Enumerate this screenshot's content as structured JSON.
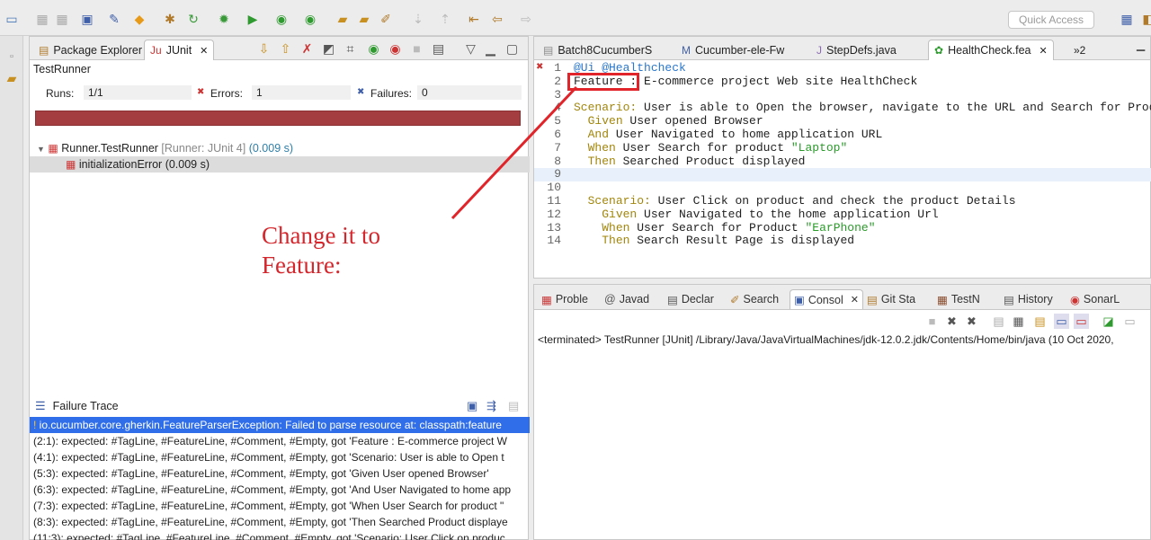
{
  "toolbar": {
    "quick_access_placeholder": "Quick Access"
  },
  "left_panel": {
    "tabs": [
      {
        "label": "Package Explorer"
      },
      {
        "label": "JUnit"
      }
    ],
    "runner_title": "TestRunner",
    "stats": {
      "runs_label": "Runs:",
      "runs_value": "1/1",
      "errors_label": "Errors:",
      "errors_value": "1",
      "failures_label": "Failures:",
      "failures_value": "0"
    },
    "progress": {
      "fraction": 1.0,
      "status": "failed",
      "color": "#a33d3f"
    },
    "tree": {
      "root": {
        "name": "Runner.TestRunner",
        "runner": "[Runner: JUnit 4]",
        "time": "(0.009 s)"
      },
      "child": {
        "name": "initializationError (0.009 s)"
      }
    },
    "failure_trace": {
      "title": "Failure Trace",
      "lines": [
        "io.cucumber.core.gherkin.FeatureParserException: Failed to parse resource at: classpath:feature",
        "(2:1): expected: #TagLine, #FeatureLine, #Comment, #Empty, got 'Feature : E-commerce project W",
        "(4:1): expected: #TagLine, #FeatureLine, #Comment, #Empty, got 'Scenario: User is able to Open t",
        "(5:3): expected: #TagLine, #FeatureLine, #Comment, #Empty, got 'Given User opened Browser'",
        "(6:3): expected: #TagLine, #FeatureLine, #Comment, #Empty, got 'And User Navigated to home app",
        "(7:3): expected: #TagLine, #FeatureLine, #Comment, #Empty, got 'When User Search for product \"",
        "(8:3): expected: #TagLine, #FeatureLine, #Comment, #Empty, got 'Then Searched Product displaye",
        "(11:3): expected: #TagLine, #FeatureLine, #Comment, #Empty, got 'Scenario: User Click on produc"
      ]
    }
  },
  "editor": {
    "tabs": [
      {
        "label": "Batch8CucumberS"
      },
      {
        "label": "Cucumber-ele-Fw"
      },
      {
        "label": "StepDefs.java"
      },
      {
        "label": "HealthCheck.fea"
      },
      {
        "label": "»2"
      }
    ],
    "lines": [
      {
        "n": "1",
        "tags": "@Ui @Healthcheck"
      },
      {
        "n": "2",
        "text": "Feature : E-commerce project Web site HealthCheck"
      },
      {
        "n": "3",
        "text": ""
      },
      {
        "n": "4",
        "kw": "Scenario:",
        "text": " User is able to Open the browser, navigate to the URL and Search for Produ"
      },
      {
        "n": "5",
        "indent": "  ",
        "kw": "Given",
        "text": " User opened Browser"
      },
      {
        "n": "6",
        "indent": "  ",
        "kw": "And",
        "text": " User Navigated to home application URL"
      },
      {
        "n": "7",
        "indent": "  ",
        "kw": "When",
        "text": " User Search for product ",
        "str": "\"Laptop\""
      },
      {
        "n": "8",
        "indent": "  ",
        "kw": "Then",
        "text": " Searched Product displayed"
      },
      {
        "n": "9",
        "text": ""
      },
      {
        "n": "10",
        "text": ""
      },
      {
        "n": "11",
        "indent": "  ",
        "kw": "Scenario:",
        "text": " User Click on product and check the product Details"
      },
      {
        "n": "12",
        "indent": "    ",
        "kw": "Given",
        "text": " User Navigated to the home application Url"
      },
      {
        "n": "13",
        "indent": "    ",
        "kw": "When",
        "text": " User Search for Product ",
        "str": "\"EarPhone\""
      },
      {
        "n": "14",
        "indent": "    ",
        "kw": "Then",
        "text": " Search Result Page is displayed"
      }
    ]
  },
  "bottom_panel": {
    "tabs": [
      {
        "label": "Proble"
      },
      {
        "label": "Javad"
      },
      {
        "label": "Declar"
      },
      {
        "label": "Search"
      },
      {
        "label": "Consol"
      },
      {
        "label": "Git Sta"
      },
      {
        "label": "TestN"
      },
      {
        "label": "History"
      },
      {
        "label": "SonarL"
      }
    ],
    "console_text": "<terminated> TestRunner [JUnit] /Library/Java/JavaVirtualMachines/jdk-12.0.2.jdk/Contents/Home/bin/java (10 Oct 2020,"
  },
  "annotation": {
    "line1": "Change it to",
    "line2": "Feature:",
    "color": "#d4272d"
  }
}
